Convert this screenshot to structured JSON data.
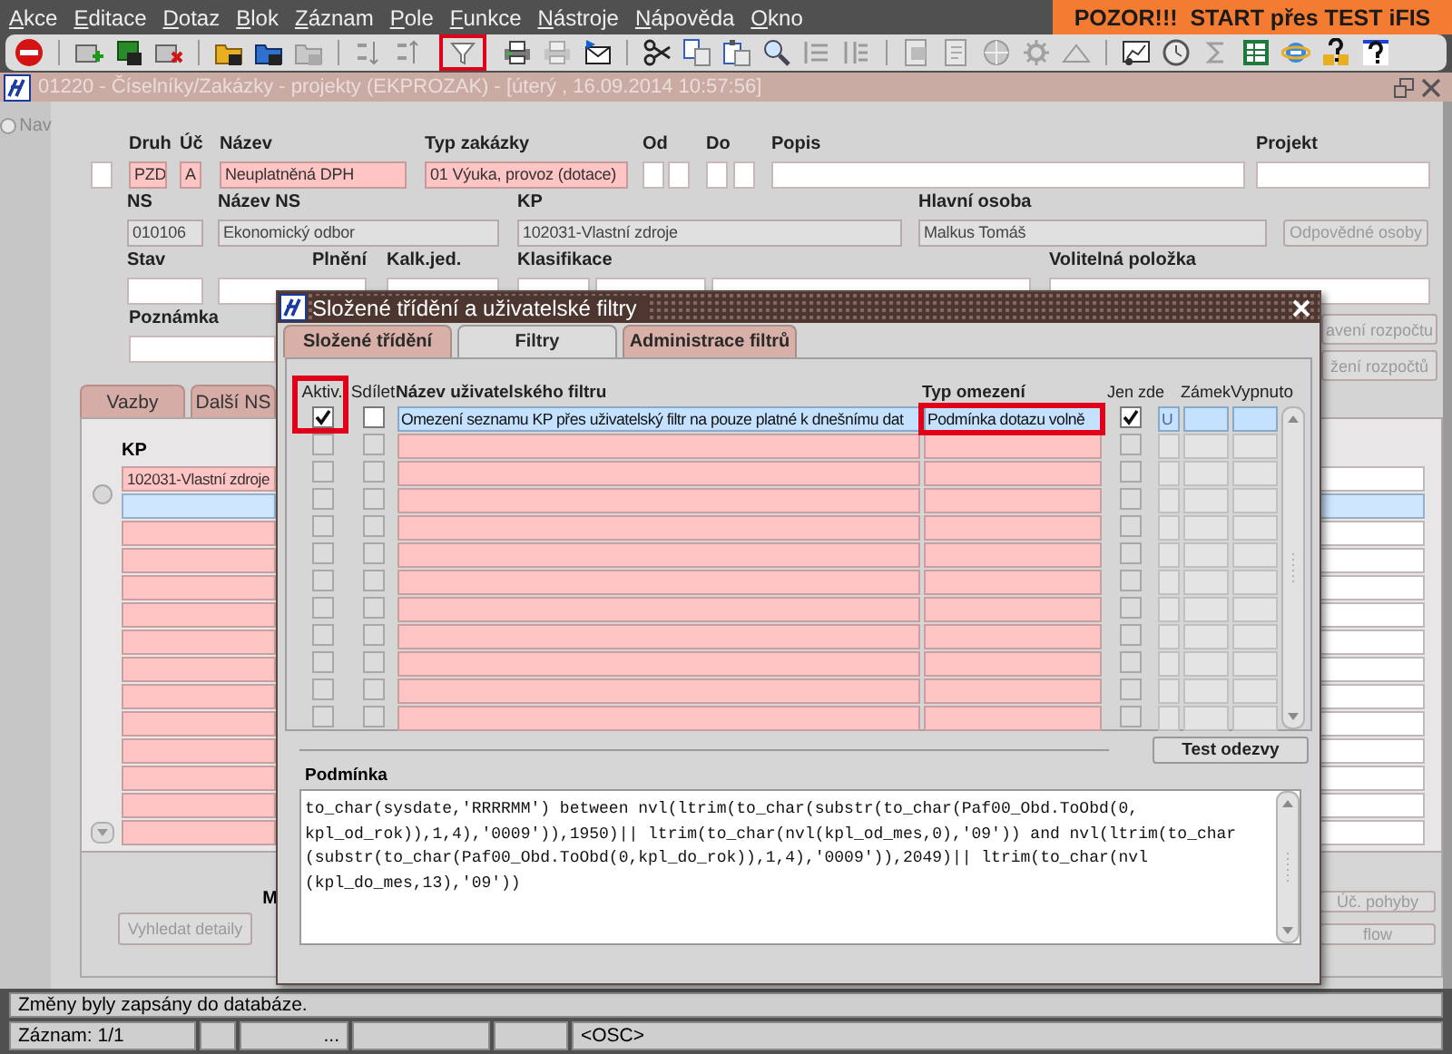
{
  "menu": [
    "Akce",
    "Editace",
    "Dotaz",
    "Blok",
    "Záznam",
    "Pole",
    "Funkce",
    "Nástroje",
    "Nápověda",
    "Okno"
  ],
  "banner": "POZOR!!!  START přes TEST iFIS",
  "toolbar": {
    "filter_highlighted": true
  },
  "window": {
    "title": "01220 - Číselníky/Zakázky - projekty (EKPROZAK) - [úterý , 16.09.2014 10:57:56]"
  },
  "nav": {
    "label": "Nav",
    "selected": false
  },
  "form": {
    "selector": {
      "selected": false
    },
    "fields": [
      {
        "label": "Druh",
        "value": "PZD",
        "kind": "required"
      },
      {
        "label": "Úč",
        "value": "A",
        "kind": "required"
      },
      {
        "label": "Název",
        "value": "Neuplatněná DPH",
        "kind": "required"
      },
      {
        "label": "Typ zakázky",
        "value": "01 Výuka, provoz (dotace)",
        "kind": "required"
      },
      {
        "label": "Od",
        "kind": "editable"
      },
      {
        "kind": "editable"
      },
      {
        "label": "Do",
        "kind": "editable"
      },
      {
        "kind": "editable"
      },
      {
        "label": "Popis",
        "kind": "editable"
      },
      {
        "label": "Projekt",
        "kind": "editable"
      },
      {
        "label": "NS",
        "value": "010106",
        "kind": "readonly"
      },
      {
        "label": "Název NS",
        "value": "Ekonomický odbor",
        "kind": "readonly"
      },
      {
        "label": "KP",
        "value": "102031-Vlastní zdroje",
        "kind": "readonly"
      },
      {
        "label": "Hlavní osoba",
        "value": "Malkus Tomáš",
        "kind": "readonly"
      },
      {
        "label": "Odpovědné osoby",
        "kind": "button",
        "disabled": true
      },
      {
        "label": "Stav",
        "kind": "editable"
      },
      {
        "label": "Plnění",
        "kind": "editable"
      },
      {
        "label": "Kalk.jed.",
        "kind": "editable"
      },
      {
        "label": "Klasifikace",
        "kind": "editable"
      },
      {
        "kind": "editable"
      },
      {
        "kind": "editable"
      },
      {
        "label": "Volitelná položka",
        "kind": "editable"
      },
      {
        "label": "Poznámka",
        "kind": "editable"
      },
      {
        "label": "avení rozpočtu",
        "kind": "button",
        "disabled": true
      },
      {
        "label": "žení rozpočtů",
        "kind": "button",
        "disabled": true
      }
    ]
  },
  "related": {
    "tabs": [
      "Vazby",
      "Další NS"
    ],
    "list_label": "KP",
    "radio": {
      "selected": false
    },
    "rows": [
      {
        "value": "102031-Vlastní zdroje",
        "selected": false
      },
      {
        "selected": true
      },
      {
        "selected": false
      },
      {
        "selected": false
      },
      {
        "selected": false
      },
      {
        "selected": false
      },
      {
        "selected": false
      },
      {
        "selected": false
      },
      {
        "selected": false
      },
      {
        "selected": false
      },
      {
        "selected": false
      },
      {
        "selected": false
      },
      {
        "selected": false
      },
      {
        "selected": false
      }
    ]
  },
  "bottom": {
    "label": "M",
    "buttons": [
      {
        "label": "Vyhledat detaily",
        "disabled": true
      },
      {
        "label": "Úč. pohyby",
        "disabled": true
      },
      {
        "label": "flow",
        "disabled": true
      }
    ]
  },
  "dialog": {
    "title": "Složené třídění a uživatelské filtry",
    "tabs": [
      {
        "label": "Složené třídění",
        "selected": false
      },
      {
        "label": "Filtry",
        "selected": true
      },
      {
        "label": "Administrace filtrů",
        "selected": false
      }
    ],
    "columns": [
      "Aktiv.",
      "Sdílet",
      "Název uživatelského filtru",
      "Typ omezení",
      "Jen zde",
      "Zámek",
      "Vypnuto"
    ],
    "rows": [
      {
        "active": true,
        "shared": false,
        "name": "Omezení seznamu KP přes uživatelský filtr na pouze platné k dnešnímu dat",
        "type": "Podmínka dotazu volně",
        "only_here": true,
        "lock": "U",
        "selected": true,
        "marked_active": true,
        "marked_type": true
      },
      {
        "active": false,
        "shared": false,
        "only_here": false,
        "selected": false,
        "marked_active": false,
        "marked_type": false
      },
      {
        "active": false,
        "shared": false,
        "only_here": false,
        "selected": false,
        "marked_active": false,
        "marked_type": false
      },
      {
        "active": false,
        "shared": false,
        "only_here": false,
        "selected": false,
        "marked_active": false,
        "marked_type": false
      },
      {
        "active": false,
        "shared": false,
        "only_here": false,
        "selected": false,
        "marked_active": false,
        "marked_type": false
      },
      {
        "active": false,
        "shared": false,
        "only_here": false,
        "selected": false,
        "marked_active": false,
        "marked_type": false
      },
      {
        "active": false,
        "shared": false,
        "only_here": false,
        "selected": false,
        "marked_active": false,
        "marked_type": false
      },
      {
        "active": false,
        "shared": false,
        "only_here": false,
        "selected": false,
        "marked_active": false,
        "marked_type": false
      },
      {
        "active": false,
        "shared": false,
        "only_here": false,
        "selected": false,
        "marked_active": false,
        "marked_type": false
      },
      {
        "active": false,
        "shared": false,
        "only_here": false,
        "selected": false,
        "marked_active": false,
        "marked_type": false
      },
      {
        "active": false,
        "shared": false,
        "only_here": false,
        "selected": false,
        "marked_active": false,
        "marked_type": false
      },
      {
        "active": false,
        "shared": false,
        "only_here": false,
        "selected": false,
        "marked_active": false,
        "marked_type": false
      }
    ],
    "test_button": "Test odezvy",
    "condition": {
      "label": "Podmínka",
      "lines": [
        "to_char(sysdate,'RRRRMM') between nvl(ltrim(to_char(substr(to_char(Paf00_Obd.ToObd(0,",
        "kpl_od_rok)),1,4),'0009')),1950)|| ltrim(to_char(nvl(kpl_od_mes,0),'09')) and nvl(ltrim(to_char",
        "(substr(to_char(Paf00_Obd.ToObd(0,kpl_do_rok)),1,4),'0009')),2049)|| ltrim(to_char(nvl",
        "(kpl_do_mes,13),'09'))"
      ]
    }
  },
  "status_bar": {
    "message": "Změny byly zapsány do databáze.",
    "segments": [
      "Záznam: 1/1",
      "...",
      "<OSC>"
    ]
  }
}
